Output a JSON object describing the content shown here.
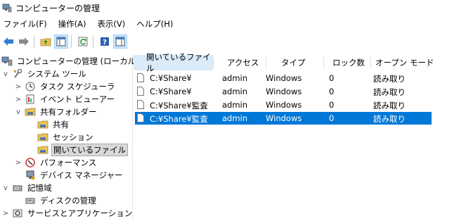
{
  "window": {
    "title": "コンピューターの管理"
  },
  "menu": [
    "ファイル(F)",
    "操作(A)",
    "表示(V)",
    "ヘルプ(H)"
  ],
  "toolbar": {
    "buttons": [
      "back-icon",
      "forward-icon",
      "up-folder-icon",
      "show-hide-tree-icon",
      "refresh-icon",
      "help-icon",
      "show-hide-action-pane-icon"
    ]
  },
  "tree": [
    {
      "label": "コンピューターの管理 (ローカル)",
      "icon": "computer-management-icon",
      "level": 0,
      "expander": ""
    },
    {
      "label": "システム ツール",
      "icon": "tools-icon",
      "level": 0,
      "expander": "v"
    },
    {
      "label": "タスク スケジューラ",
      "icon": "clock-icon",
      "level": 1,
      "expander": ">"
    },
    {
      "label": "イベント ビューアー",
      "icon": "event-viewer-icon",
      "level": 1,
      "expander": ">"
    },
    {
      "label": "共有フォルダー",
      "icon": "shared-folder-icon",
      "level": 1,
      "expander": "v"
    },
    {
      "label": "共有",
      "icon": "shared-folder-icon",
      "level": 2,
      "expander": ""
    },
    {
      "label": "セッション",
      "icon": "shared-folder-icon",
      "level": 2,
      "expander": ""
    },
    {
      "label": "開いているファイル",
      "icon": "shared-folder-icon",
      "level": 2,
      "expander": "",
      "selected": true
    },
    {
      "label": "パフォーマンス",
      "icon": "performance-icon",
      "level": 1,
      "expander": ">"
    },
    {
      "label": "デバイス マネージャー",
      "icon": "device-manager-icon",
      "level": 1,
      "expander": ""
    },
    {
      "label": "記憶域",
      "icon": "storage-icon",
      "level": 0,
      "expander": "v"
    },
    {
      "label": "ディスクの管理",
      "icon": "disk-icon",
      "level": 1,
      "expander": ""
    },
    {
      "label": "サービスとアプリケーション",
      "icon": "services-icon",
      "level": 0,
      "expander": ">"
    }
  ],
  "columns": [
    "開いているファイル",
    "アクセス",
    "タイプ",
    "ロック数",
    "オープン モード"
  ],
  "rows": [
    {
      "file": "C:¥Share¥",
      "access": "admin",
      "type": "Windows",
      "locks": "0",
      "mode": "読み取り"
    },
    {
      "file": "C:¥Share¥",
      "access": "admin",
      "type": "Windows",
      "locks": "0",
      "mode": "読み取り"
    },
    {
      "file": "C:¥Share¥監査",
      "access": "admin",
      "type": "Windows",
      "locks": "0",
      "mode": "読み取り"
    },
    {
      "file": "C:¥Share¥監査",
      "access": "admin",
      "type": "Windows",
      "locks": "0",
      "mode": "読み取り",
      "selected": true
    }
  ],
  "colors": {
    "selection": "#0078d7",
    "toolbar_selected": "#cce8ff"
  }
}
